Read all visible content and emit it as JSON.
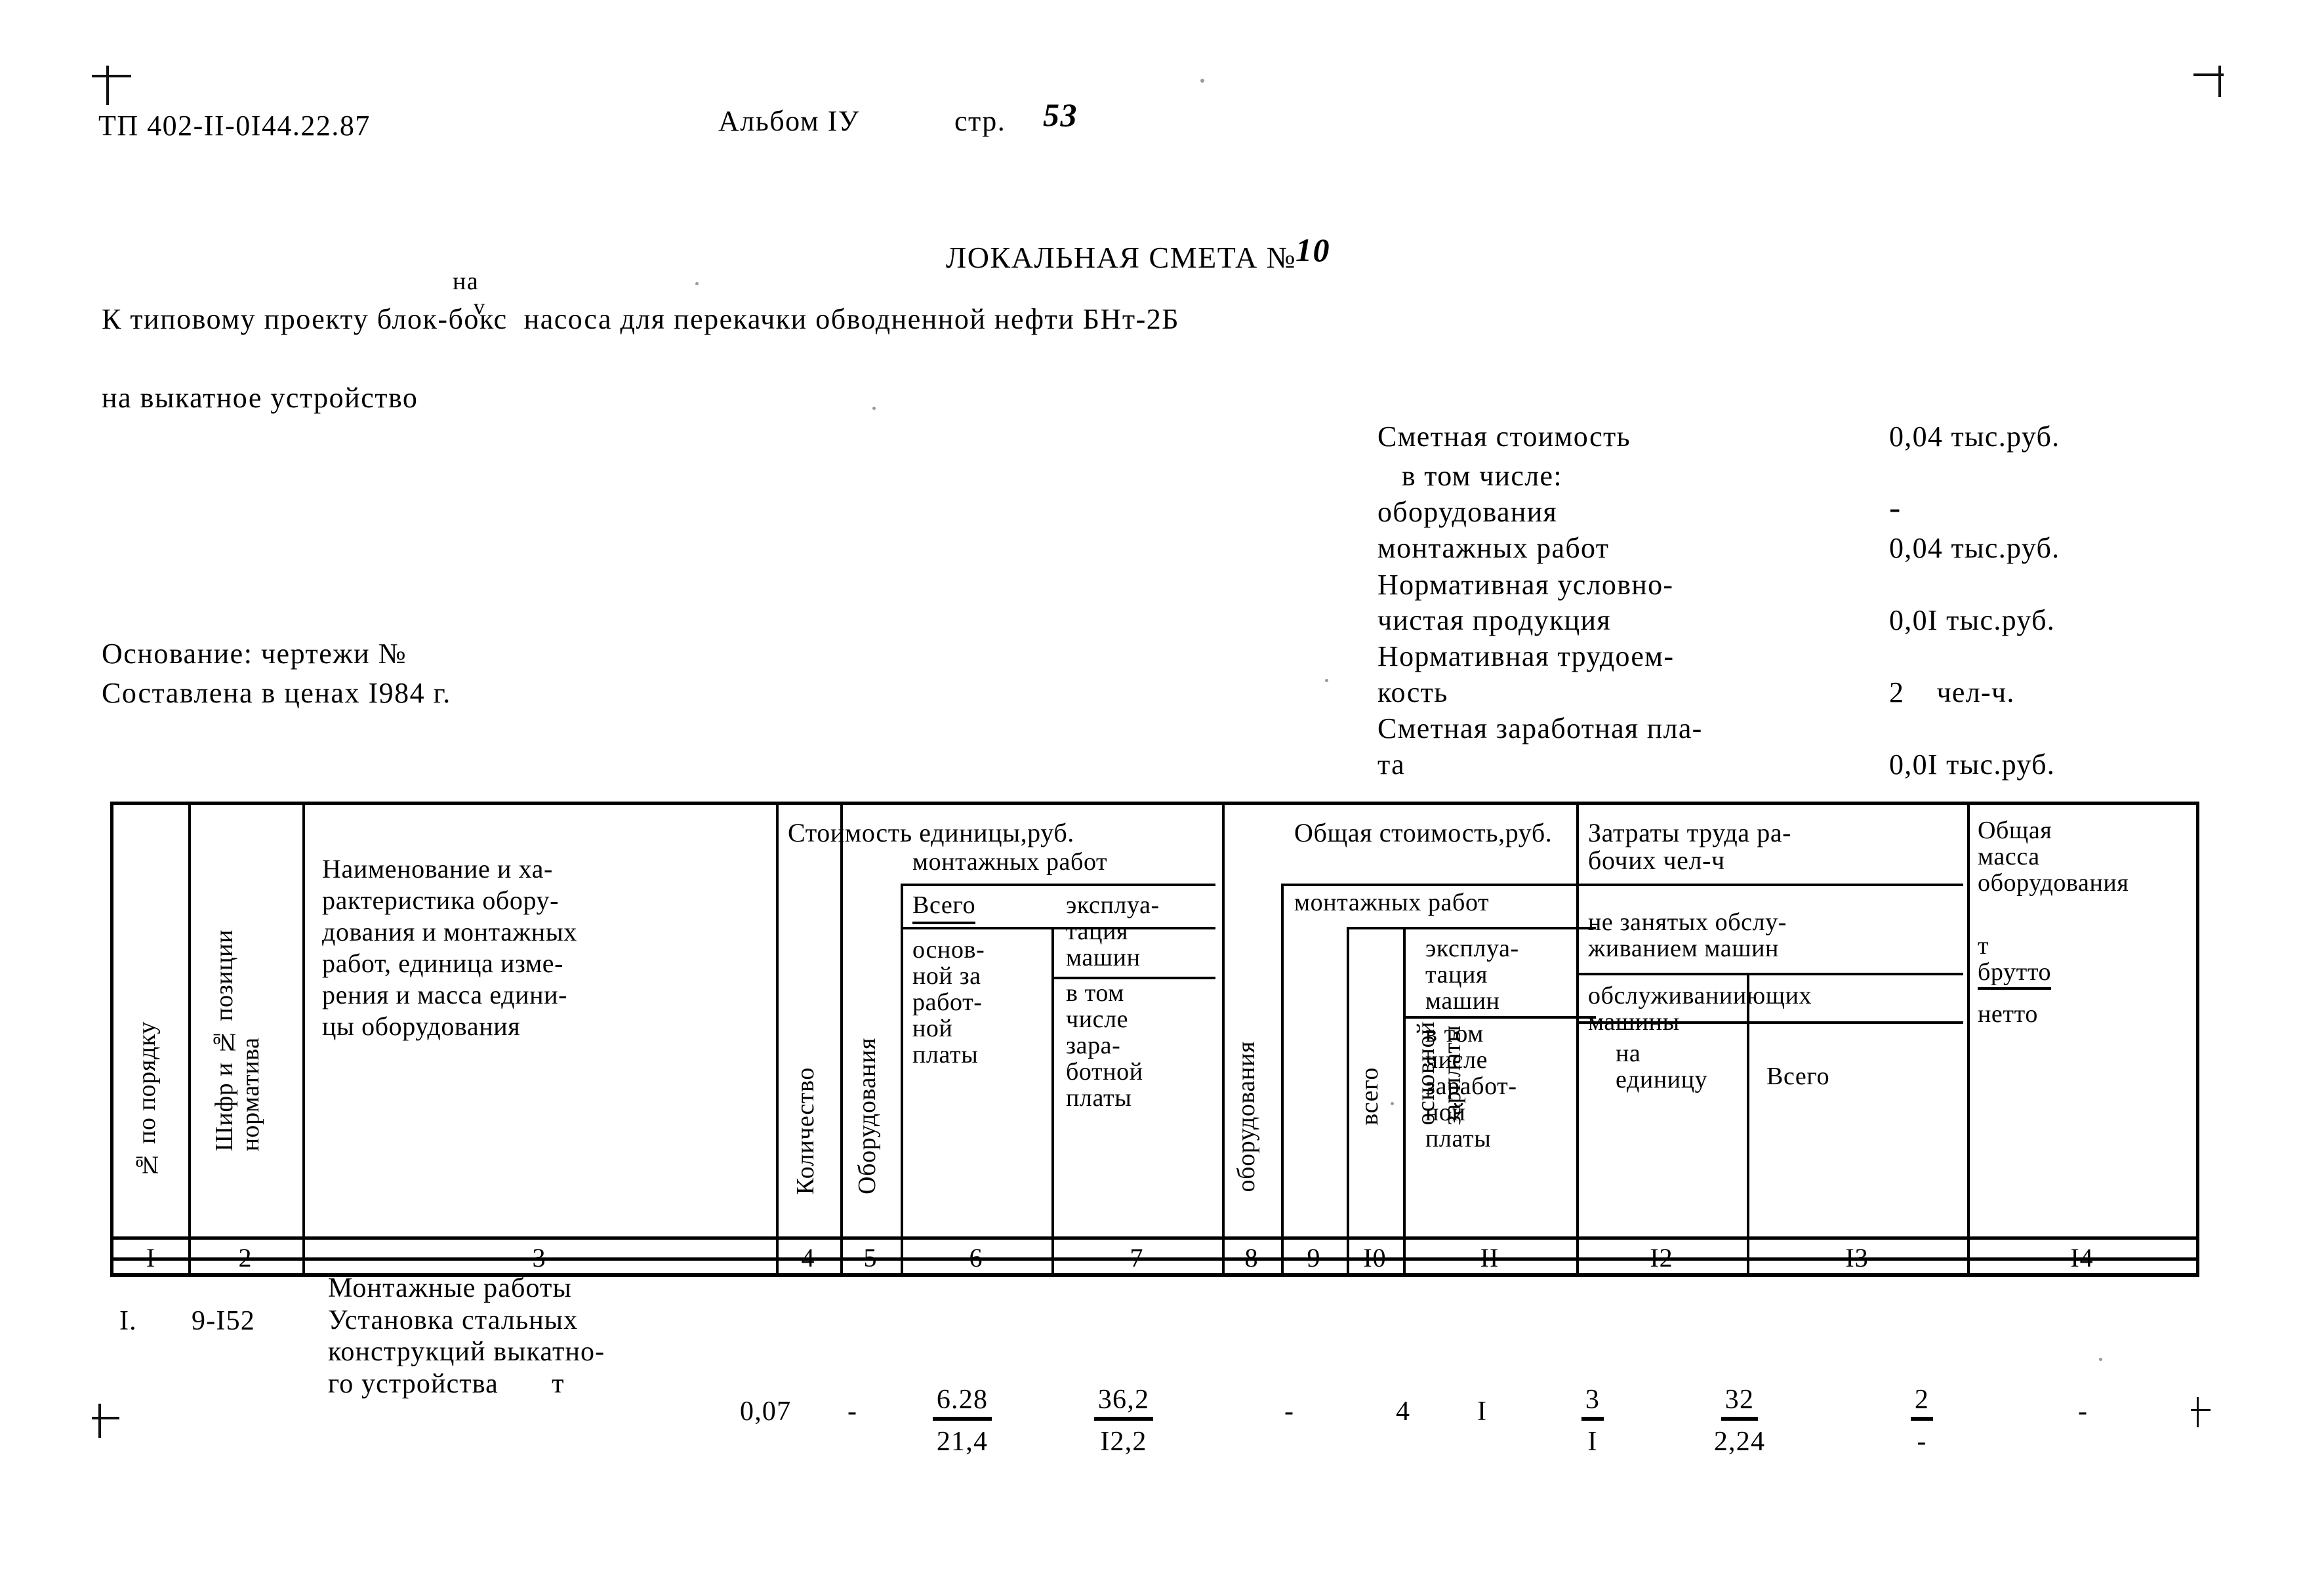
{
  "header": {
    "doc_code": "ТП 402-II-0I44.22.87",
    "album_label": "Альбом IУ",
    "page_label": "стр.",
    "page_number": "53"
  },
  "title": {
    "estimate_title": "ЛОКАЛЬНАЯ СМЕТА №",
    "estimate_number": "10",
    "subject_line_1": "К типовому проекту блок-бокс  насоса для перекачки обводненной нефти БНт-2Б",
    "inserted_word": "на",
    "caret": "v",
    "subject_line_2": "на выкатное устройство"
  },
  "basis": {
    "basis_line": "Основание: чертежи №",
    "prices_line": "Составлена в ценах I984 г."
  },
  "summary": {
    "rows": [
      {
        "label": "Сметная стоимость",
        "value": "0,04 тыс.руб."
      },
      {
        "label": "   в том числе:",
        "value": ""
      },
      {
        "label": "оборудования",
        "value": "-"
      },
      {
        "label": "монтажных работ",
        "value": "0,04 тыс.руб."
      },
      {
        "label": "Нормативная условно-",
        "value": ""
      },
      {
        "label": "чистая продукция",
        "value": "0,0I тыс.руб."
      },
      {
        "label": "Нормативная трудоем-",
        "value": ""
      },
      {
        "label": "кость",
        "value": "2    чел-ч."
      },
      {
        "label": "Сметная заработная пла-",
        "value": ""
      },
      {
        "label": "та",
        "value": "0,0I тыс.руб."
      }
    ]
  },
  "table": {
    "group_headers": {
      "unit_cost": "Стоимость единицы,руб.",
      "total_cost": "Общая стоимость,руб.",
      "labor": "Затраты труда ра-\nбочих чел-ч",
      "total_mass": "Общая\nмасса\nоборудования"
    },
    "col1": "№ по порядку",
    "col2": "Шифр и № позиции\nнорматива",
    "col3": "Наименование и ха-\nрактеристика обору-\nдования и монтажных\nработ, единица изме-\nрения и масса едини-\nцы оборудования",
    "col4": "Количество",
    "col5": "Оборудования",
    "col6_group": "монтажных работ",
    "col6_total": "Всего",
    "col6_sub": "основ-\nной за\nработ-\nной\nплаты",
    "col7_top": "эксплуа-\nтация\nмашин",
    "col7_sub": "в том\nчисле\nзара-\nботной\nплаты",
    "col8": "оборудования",
    "col9_group": "монтажных работ",
    "col9": "всего",
    "col10": "основной\nзарплаты",
    "col11_top": "эксплуа-\nтация\nмашин",
    "col11_sub": "в том\nчисле\nзаработ-\nной\nплаты",
    "col12_group": "не занятых обслу-\nживанием машин",
    "col12_sub_group": "обслуживанииющих\nмашины",
    "col12": "на\nединицу",
    "col13": "Всего",
    "col14_top": "т\nбрутто",
    "col14_bottom": "нетто",
    "numbers": [
      "I",
      "2",
      "3",
      "4",
      "5",
      "6",
      "7",
      "8",
      "9",
      "I0",
      "II",
      "I2",
      "I3",
      "I4"
    ]
  },
  "rows": [
    {
      "no": "I.",
      "code": "9-I52",
      "description": "Монтажные работы\nУстановка стальных\nконструкций выкатно-\nго устройства       т",
      "quantity": "0,07",
      "equipment_unit": "-",
      "mount_total_num": "6.28",
      "mount_total_den": "21,4",
      "machine_num": "36,2",
      "machine_den": "I2,2",
      "equipment_total": "-",
      "total_all": "4",
      "base_salary": "I",
      "machine_total_num": "3",
      "machine_total_den": "I",
      "labor_unit_num": "32",
      "labor_unit_den": "2,24",
      "labor_total_num": "2",
      "labor_total_den": "-",
      "mass": "-"
    }
  ]
}
